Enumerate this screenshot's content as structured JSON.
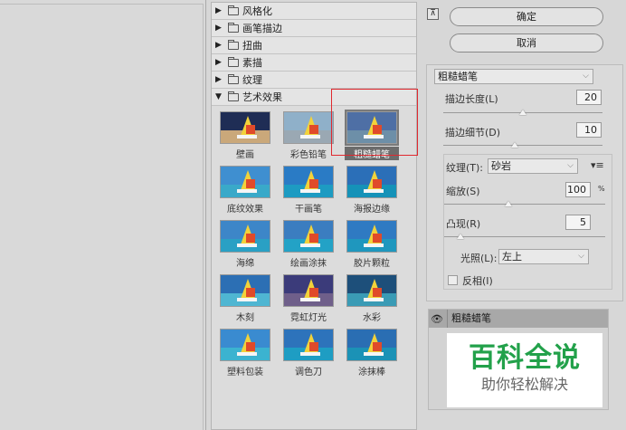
{
  "categories": [
    {
      "label": "风格化",
      "expanded": false
    },
    {
      "label": "画笔描边",
      "expanded": false
    },
    {
      "label": "扭曲",
      "expanded": false
    },
    {
      "label": "素描",
      "expanded": false
    },
    {
      "label": "纹理",
      "expanded": false
    },
    {
      "label": "艺术效果",
      "expanded": true
    }
  ],
  "thumbnails": [
    {
      "label": "壁画"
    },
    {
      "label": "彩色铅笔"
    },
    {
      "label": "粗糙蜡笔",
      "selected": true
    },
    {
      "label": "底纹效果"
    },
    {
      "label": "干画笔"
    },
    {
      "label": "海报边缘"
    },
    {
      "label": "海绵"
    },
    {
      "label": "绘画涂抹"
    },
    {
      "label": "胶片颗粒"
    },
    {
      "label": "木刻"
    },
    {
      "label": "霓虹灯光"
    },
    {
      "label": "水彩"
    },
    {
      "label": "塑料包装"
    },
    {
      "label": "调色刀"
    },
    {
      "label": "涂抹棒"
    }
  ],
  "buttons": {
    "ok": "确定",
    "cancel": "取消"
  },
  "settings": {
    "filter_select": "粗糙蜡笔",
    "stroke_length_label": "描边长度(L)",
    "stroke_length_value": "20",
    "stroke_length_fraction": 0.5,
    "stroke_detail_label": "描边细节(D)",
    "stroke_detail_value": "10",
    "stroke_detail_fraction": 0.45,
    "texture_label": "纹理(T):",
    "texture_value": "砂岩",
    "texture_menu_icon": "▾≡",
    "scaling_label": "缩放(S)",
    "scaling_value": "100",
    "scaling_unit": "%",
    "scaling_fraction": 0.4,
    "relief_label": "凸现(R)",
    "relief_value": "5",
    "relief_fraction": 0.1,
    "light_label": "光照(L):",
    "light_value": "左上",
    "invert_label": "反相(I)",
    "invert_checked": false
  },
  "layers": {
    "active_layer": "粗糙蜡笔"
  },
  "watermark": {
    "title": "百科全说",
    "subtitle": "助你轻松解决"
  },
  "colors": {
    "selection_outline": "#e0292f",
    "watermark_green": "#22a14a"
  }
}
